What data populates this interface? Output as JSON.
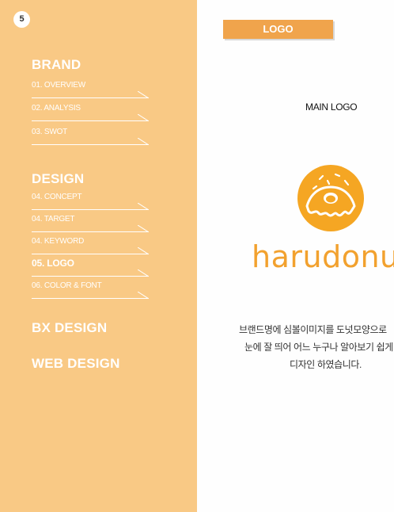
{
  "page_number": "5",
  "sidebar": {
    "sections": {
      "brand": "BRAND",
      "design": "DESIGN",
      "bx_design": "BX DESIGN",
      "web_design": "WEB DESIGN"
    },
    "items": [
      {
        "label": "01. OVERVIEW"
      },
      {
        "label": "02. ANALYSIS"
      },
      {
        "label": "03. SWOT"
      },
      {
        "label": "04. CONCEPT"
      },
      {
        "label": "04. TARGET"
      },
      {
        "label": "04. KEYWORD"
      },
      {
        "label": "05. LOGO"
      },
      {
        "label": "06. COLOR & FONT"
      }
    ]
  },
  "main": {
    "tag": "LOGO",
    "logo_label": "MAIN LOGO",
    "wordmark": "harudonut",
    "description": [
      "브랜드명에 심볼이미지를 도넛모양으로",
      "눈에 잘 띄어 어느 누구나 알아보기 쉽게",
      "디자인 하였습니다."
    ]
  },
  "colors": {
    "sidebar_bg": "#f9c985",
    "accent": "#f0a44c",
    "donut": "#f5a623"
  }
}
